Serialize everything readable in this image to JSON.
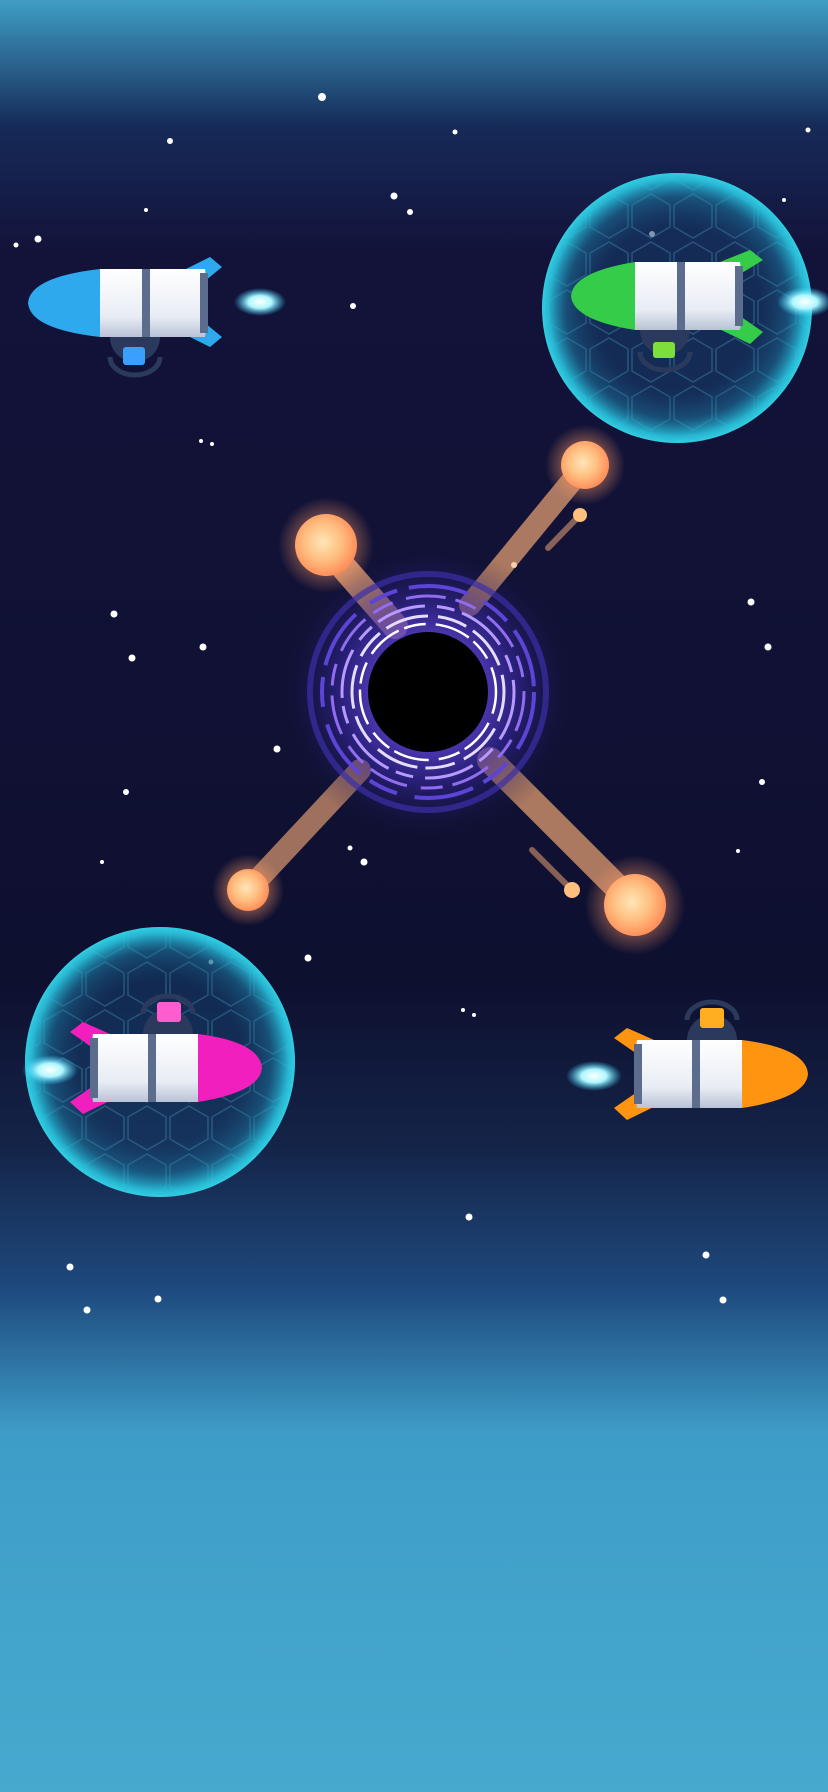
{
  "scene": {
    "background": {
      "top": "#3f9ec5",
      "night": "#13133a",
      "deep": "#0e1030",
      "horizon": "#1c3f75",
      "bottom": "#47a9ce"
    },
    "black_hole": {
      "core": "#000000",
      "swirl": "#8f6cf0",
      "glow": "#5a3fc8"
    },
    "beam_color": "#ffb07a",
    "orb_color": "#ffbf7e",
    "shield_color": "#25c7df",
    "exhaust_color": "#8ff3ff",
    "rockets": [
      {
        "name": "blue-rocket",
        "accent": "#2ea9ee",
        "cargo": "#3aa0ff",
        "direction": "left",
        "shielded": false
      },
      {
        "name": "green-rocket",
        "accent": "#35cc4a",
        "cargo": "#7de03a",
        "direction": "left",
        "shielded": true
      },
      {
        "name": "pink-rocket",
        "accent": "#f01fbd",
        "cargo": "#ff5ccf",
        "direction": "right",
        "shielded": true
      },
      {
        "name": "orange-rocket",
        "accent": "#ff9410",
        "cargo": "#ffae22",
        "direction": "right",
        "shielded": false
      }
    ]
  }
}
